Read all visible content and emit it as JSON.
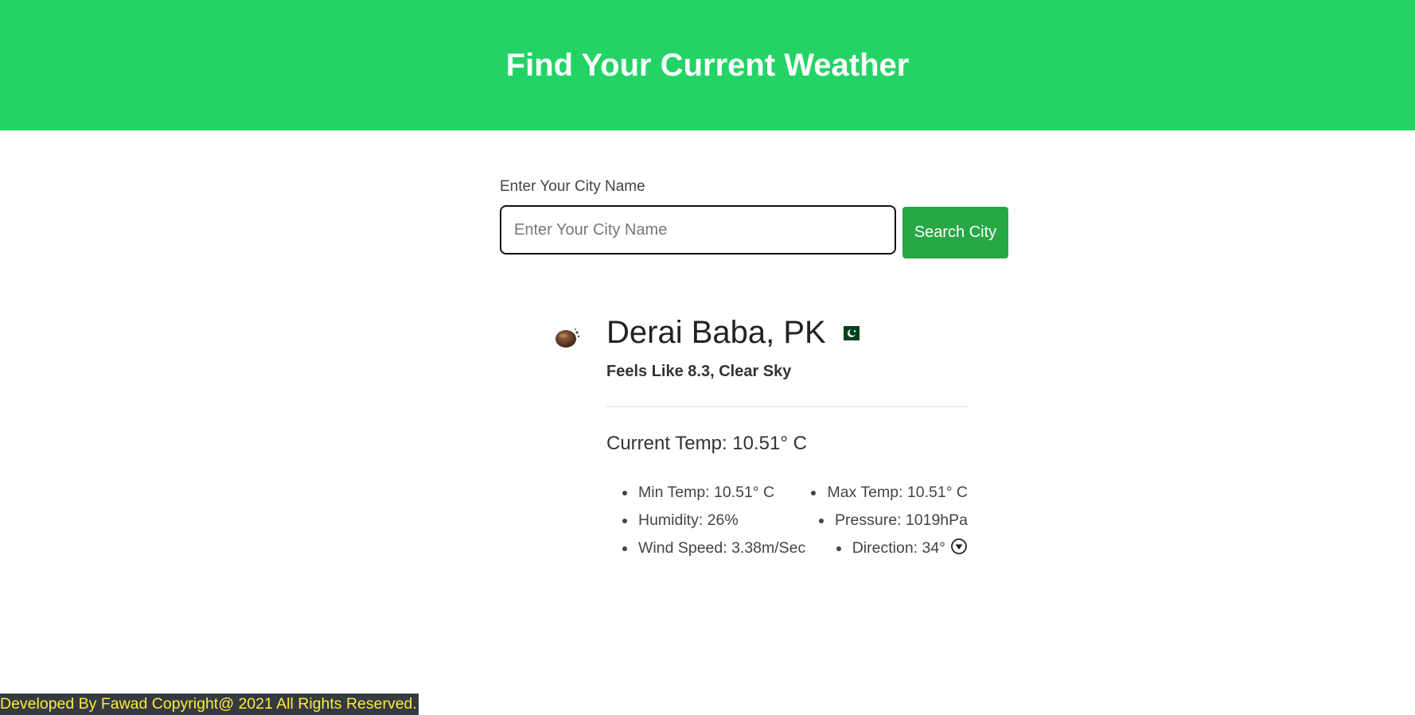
{
  "header": {
    "title": "Find Your Current Weather"
  },
  "search": {
    "label": "Enter Your City Name",
    "placeholder": "Enter Your City Name",
    "value": "",
    "button_label": "Search City"
  },
  "weather": {
    "icon": "clear-sky-night-icon",
    "city": "Derai Baba, PK",
    "flag_icon": "pakistan-flag-icon",
    "feels_like": "Feels Like 8.3, Clear Sky",
    "current_temp": "Current Temp: 10.51° C",
    "stats": {
      "min_temp": "Min Temp: 10.51° C",
      "max_temp": "Max Temp: 10.51° C",
      "humidity": "Humidity: 26%",
      "pressure": "Pressure: 1019hPa",
      "wind_speed": "Wind Speed: 3.38m/Sec",
      "direction": "Direction: 34°",
      "direction_icon": "wind-direction-arrow-icon"
    }
  },
  "footer": {
    "text": "Developed By Fawad Copyright@ 2021 All Rights Reserved."
  },
  "colors": {
    "header_bg": "#24d366",
    "button_bg": "#28a745",
    "footer_bg": "#343a40",
    "footer_text": "#ffeb3b"
  }
}
